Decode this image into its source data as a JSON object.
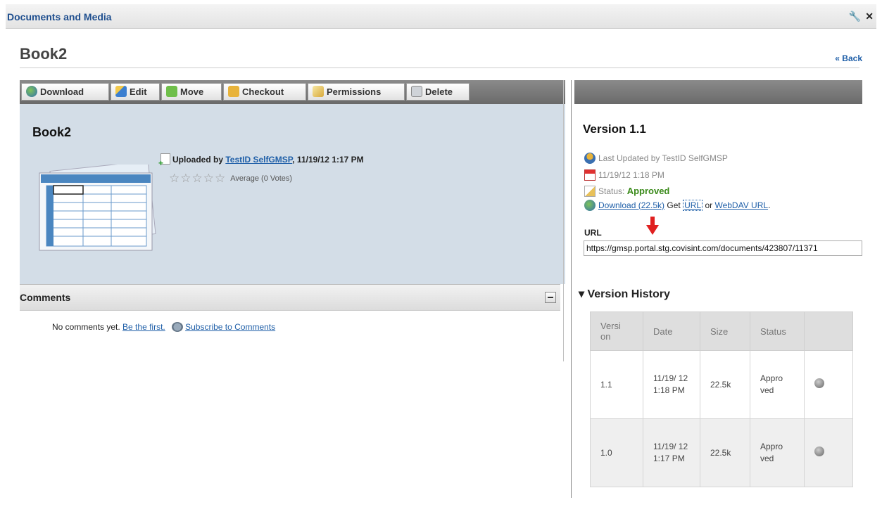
{
  "portlet": {
    "title": "Documents and Media",
    "wrench_icon": "wrench-icon",
    "close_icon": "close-icon"
  },
  "header": {
    "title": "Book2",
    "back_label": "« Back"
  },
  "toolbar": {
    "buttons": [
      {
        "label": "Download",
        "icon": "download-icon"
      },
      {
        "label": "Edit",
        "icon": "edit-icon"
      },
      {
        "label": "Move",
        "icon": "move-icon"
      },
      {
        "label": "Checkout",
        "icon": "lock-icon"
      },
      {
        "label": "Permissions",
        "icon": "permissions-icon"
      },
      {
        "label": "Delete",
        "icon": "trash-icon"
      }
    ]
  },
  "document": {
    "title": "Book2",
    "uploaded_prefix": "Uploaded by ",
    "uploader": "TestID SelfGMSP",
    "uploaded_suffix": ", 11/19/12 1:17 PM",
    "rating_text": "Average (0 Votes)",
    "stars": 0,
    "stars_max": 5
  },
  "comments": {
    "title": "Comments",
    "empty_text": "No comments yet.",
    "be_first": "Be the first.",
    "subscribe": "Subscribe to Comments"
  },
  "version": {
    "title": "Version 1.1",
    "last_updated": "Last Updated by TestID SelfGMSP",
    "date": "11/19/12 1:18 PM",
    "status_label": "Status: ",
    "status_value": "Approved",
    "download_link": "Download (22.5k)",
    "get_text": "Get",
    "url_link": "URL",
    "or_text": "or",
    "webdav_link": "WebDAV URL",
    "url_label": "URL",
    "url_value": "https://gmsp.portal.stg.covisint.com/documents/423807/11371"
  },
  "history": {
    "title": "Version History",
    "columns": [
      "Versi on",
      "Date",
      "Size",
      "Status",
      ""
    ],
    "rows": [
      {
        "version": "1.1",
        "date": "11/19/ 12 1:18 PM",
        "size": "22.5k",
        "status": "Appro ved"
      },
      {
        "version": "1.0",
        "date": "11/19/ 12 1:17 PM",
        "size": "22.5k",
        "status": "Appro ved"
      }
    ]
  },
  "colors": {
    "accent_link": "#1f5fa8",
    "approved": "#3a8a1a",
    "panel_bg": "#d3dde7",
    "arrow": "#e02020"
  }
}
